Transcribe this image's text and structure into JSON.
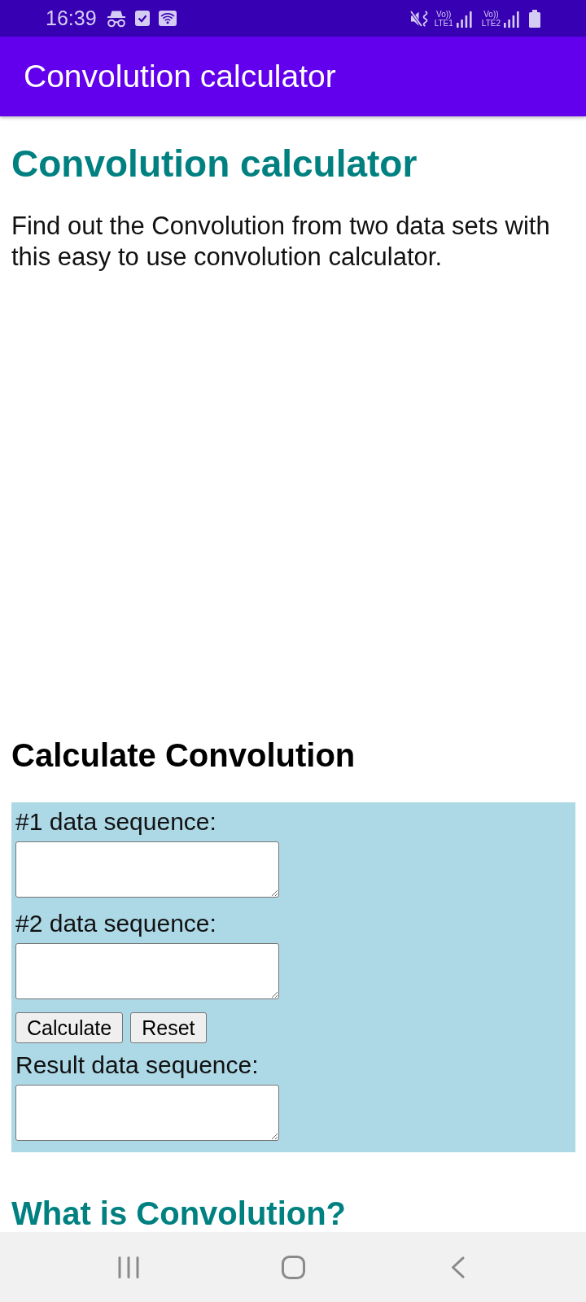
{
  "status_bar": {
    "time": "16:39",
    "sim_slots": [
      {
        "voice": "Vo))",
        "network": "LTE1"
      },
      {
        "voice": "Vo))",
        "network": "LTE2"
      }
    ]
  },
  "app_bar": {
    "title": "Convolution calculator"
  },
  "page": {
    "title": "Convolution calculator",
    "intro": "Find out the Convolution from two data sets with this easy to use convolution calculator."
  },
  "calculator": {
    "title": "Calculate Convolution",
    "inputs": [
      {
        "label": "#1 data sequence:"
      },
      {
        "label": "#2 data sequence:"
      }
    ],
    "buttons": [
      "Calculate",
      "Reset"
    ],
    "result": {
      "label": "Result data sequence:"
    }
  },
  "next_section": {
    "title": "What is Convolution?"
  }
}
